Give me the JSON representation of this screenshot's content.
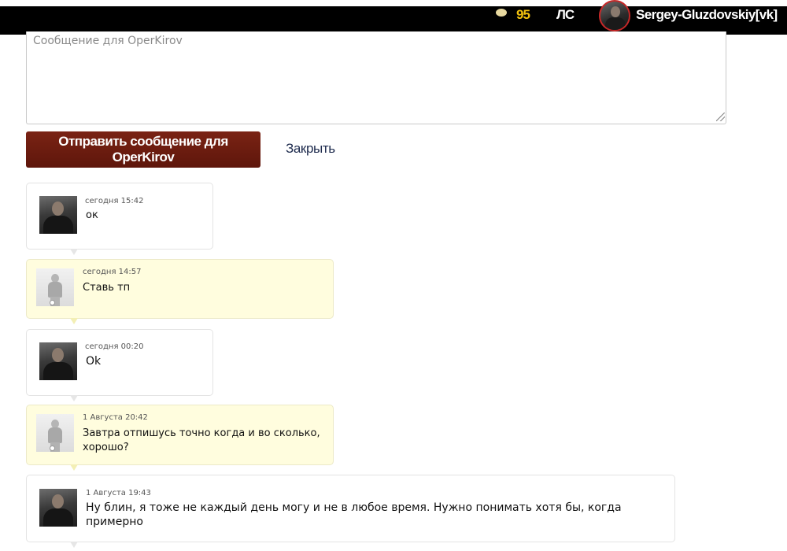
{
  "topbar": {
    "coin_icon": "coin-icon",
    "coins": "95",
    "ls_label": "ЛС",
    "username": "Sergey-Gluzdovskiy[vk]"
  },
  "composer": {
    "placeholder": "Сообщение для OperKirov",
    "value": "",
    "send_label": "Отправить сообщение для OperKirov",
    "close_label": "Закрыть"
  },
  "messages": [
    {
      "side": "mine",
      "time": "сегодня 15:42",
      "text": "ок"
    },
    {
      "side": "theirs",
      "time": "сегодня 14:57",
      "text": "Ставь тп"
    },
    {
      "side": "mine",
      "time": "сегодня 00:20",
      "text": "Ok"
    },
    {
      "side": "theirs",
      "time": "1 Августа 20:42",
      "text": "Завтра отпишусь точно когда и во сколько, хорошо?"
    },
    {
      "side": "mine",
      "time": "1 Августа 19:43",
      "text": "Ну блин, я тоже не каждый день могу и не в любое время. Нужно понимать хотя бы, когда примерно"
    }
  ],
  "colors": {
    "send_button": "#6e1d10",
    "their_bubble": "#fffdde",
    "coins": "#f2c20e",
    "avatar_ring": "#c62828"
  }
}
